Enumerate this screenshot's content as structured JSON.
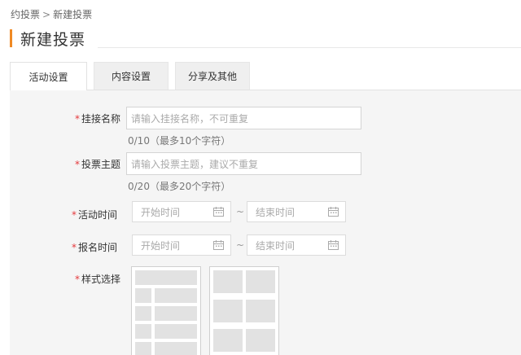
{
  "breadcrumb": {
    "parent": "约投票",
    "separator": ">",
    "current": "新建投票"
  },
  "page_title": "新建投票",
  "tabs": [
    {
      "label": "活动设置",
      "active": true
    },
    {
      "label": "内容设置",
      "active": false
    },
    {
      "label": "分享及其他",
      "active": false
    }
  ],
  "form": {
    "required_mark": "*",
    "mount_name": {
      "label": "挂接名称",
      "placeholder": "请输入挂接名称，不可重复",
      "hint": "0/10（最多10个字符）"
    },
    "vote_subject": {
      "label": "投票主题",
      "placeholder": "请输入投票主题，建议不重复",
      "hint": "0/20（最多20个字符）"
    },
    "activity_time": {
      "label": "活动时间",
      "start_placeholder": "开始时间",
      "end_placeholder": "结束时间",
      "separator": "~"
    },
    "signup_time": {
      "label": "报名时间",
      "start_placeholder": "开始时间",
      "end_placeholder": "结束时间",
      "separator": "~"
    },
    "style_select": {
      "label": "样式选择"
    }
  },
  "colors": {
    "accent": "#f08a24",
    "required": "#e4393c",
    "panel_bg": "#f5f5f5"
  },
  "icons": {
    "date_picker": "calendar-icon"
  }
}
